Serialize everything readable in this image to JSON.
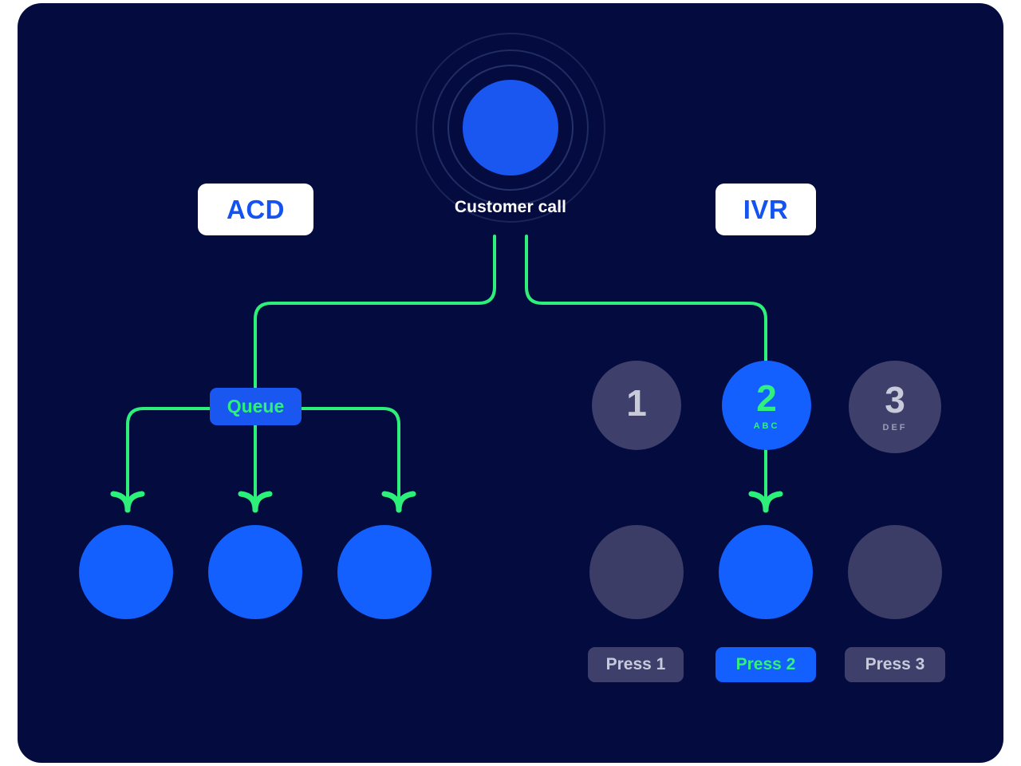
{
  "theme": {
    "canvas_bg": "#040B3E",
    "accent_blue": "#1360FF",
    "accent_green": "#2DF07A",
    "muted": "#3E406B",
    "white": "#FFFFFF"
  },
  "customer": {
    "label": "Customer call",
    "icon": "person-icon",
    "ring_count": 3
  },
  "branches": {
    "left": {
      "label": "ACD"
    },
    "right": {
      "label": "IVR"
    }
  },
  "queue": {
    "label": "Queue"
  },
  "dialpad": [
    {
      "digit": "1",
      "letters": "",
      "active": false
    },
    {
      "digit": "2",
      "letters": "ABC",
      "active": true
    },
    {
      "digit": "3",
      "letters": "DEF",
      "active": false
    }
  ],
  "press_buttons": [
    {
      "label": "Press 1",
      "active": false
    },
    {
      "label": "Press 2",
      "active": true
    },
    {
      "label": "Press 3",
      "active": false
    }
  ],
  "acd_agents": [
    {
      "name": "agent-1",
      "active": true
    },
    {
      "name": "agent-2",
      "active": true
    },
    {
      "name": "agent-3",
      "active": true
    }
  ],
  "ivr_agents": [
    {
      "name": "agent-1",
      "active": false
    },
    {
      "name": "agent-2",
      "active": true
    },
    {
      "name": "agent-3",
      "active": false
    }
  ]
}
